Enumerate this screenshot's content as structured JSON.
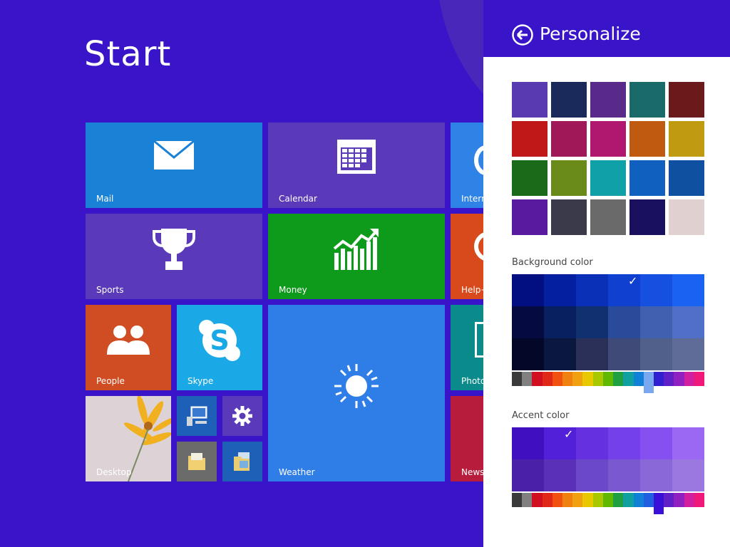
{
  "start": {
    "title": "Start",
    "tiles": {
      "mail": {
        "label": "Mail",
        "icon": "mail-icon",
        "color": "#1982d6"
      },
      "calendar": {
        "label": "Calendar",
        "icon": "calendar-icon",
        "color": "#5a3ab8"
      },
      "internet": {
        "label": "Intern",
        "icon": "internet-explorer-icon",
        "color": "#2f82e6"
      },
      "sports": {
        "label": "Sports",
        "icon": "trophy-icon",
        "color": "#5a3ab8"
      },
      "money": {
        "label": "Money",
        "icon": "chart-arrow-icon",
        "color": "#0e9a1a"
      },
      "help": {
        "label": "Help+",
        "icon": "help-icon",
        "color": "#d84a1b"
      },
      "people": {
        "label": "People",
        "icon": "people-icon",
        "color": "#d04c22"
      },
      "skype": {
        "label": "Skype",
        "icon": "skype-icon",
        "color": "#1aa8e6"
      },
      "weather": {
        "label": "Weather",
        "icon": "sun-icon",
        "color": "#2f7ee8"
      },
      "photos": {
        "label": "Photo",
        "icon": "photo-icon",
        "color": "#0a8a8a"
      },
      "desktop": {
        "label": "Desktop",
        "icon": "flower-icon",
        "color": "#d9cfcf"
      },
      "this_pc": {
        "label": "",
        "icon": "computer-icon",
        "color": "#1e5fb8"
      },
      "settings": {
        "label": "",
        "icon": "gear-icon",
        "color": "#5a3ab8"
      },
      "file_explorer": {
        "label": "",
        "icon": "folder-icon",
        "color": "#6b6b6b"
      },
      "libraries": {
        "label": "",
        "icon": "folder-library-icon",
        "color": "#1e5fb8"
      },
      "news": {
        "label": "News",
        "icon": "news-icon",
        "color": "#b81c3c"
      }
    }
  },
  "panel": {
    "title": "Personalize",
    "back_icon": "back-arrow-icon",
    "background_images": [
      "#5a3ab0",
      "#1a2a5a",
      "#5a2a8a",
      "#1a6a6a",
      "#6a1a1a",
      "#c01818",
      "#a01858",
      "#b01870",
      "#c05a10",
      "#c09a10",
      "#1a6a1a",
      "#6a8a1a",
      "#10a0a8",
      "#1060c0",
      "#1050a0",
      "#5a1aa0",
      "#3a3a4a",
      "#6a6a6a",
      "#1a1060",
      "#e0d0d0"
    ],
    "background_color_label": "Background color",
    "background_grid": [
      [
        "#020f80",
        "#0420a0",
        "#0a30b8",
        "#0f40d0",
        "#1550e0",
        "#1a62f2"
      ],
      [
        "#050a40",
        "#082060",
        "#103070",
        "#2a4a9a",
        "#4060b0",
        "#5070c8"
      ],
      [
        "#040828",
        "#0a1840",
        "#2a3058",
        "#404a78",
        "#50608a",
        "#606c98"
      ]
    ],
    "background_hues": [
      "#3a3a3a",
      "#808080",
      "#d01020",
      "#e02818",
      "#f05010",
      "#f08010",
      "#f0a010",
      "#e8c800",
      "#a8c800",
      "#60b800",
      "#20a040",
      "#10a0a0",
      "#1080d8",
      "#2060e0",
      "#3020d0",
      "#6020c8",
      "#9020c0",
      "#d020a0",
      "#f01878"
    ],
    "accent_color_label": "Accent color",
    "accent_grid": [
      [
        "#3f0fc0",
        "#5220d8",
        "#6530e0",
        "#7440ea",
        "#8650f0",
        "#9a68f2"
      ],
      [
        "#4a20a8",
        "#5a30b8",
        "#6a48c8",
        "#7a58d0",
        "#8a68d8",
        "#9a78e0"
      ]
    ],
    "accent_hues": [
      "#3a3a3a",
      "#808080",
      "#d01020",
      "#e02818",
      "#f05010",
      "#f08010",
      "#f0a010",
      "#e8c800",
      "#a8c800",
      "#60b800",
      "#20a040",
      "#10a0a0",
      "#1080d8",
      "#2060e0",
      "#3020d0",
      "#6020c8",
      "#9020c0",
      "#d020a0",
      "#f01878"
    ],
    "checkmark": "✓"
  }
}
